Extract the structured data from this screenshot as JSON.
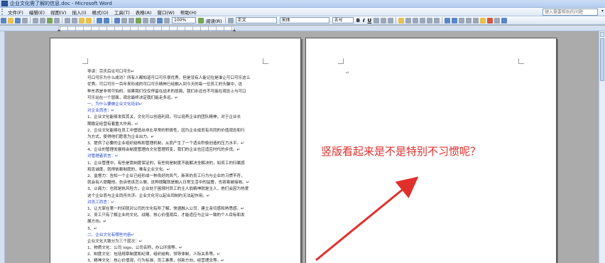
{
  "window": {
    "title": "企业文化需了解的信息.doc - Microsoft Word"
  },
  "menu": {
    "items": [
      "文件(F)",
      "编辑(E)",
      "视图(V)",
      "插入(I)",
      "格式(O)",
      "工具(T)",
      "表格(A)",
      "窗口(W)",
      "帮助(H)"
    ],
    "help_placeholder": "键入需要帮助的问题"
  },
  "toolbar": {
    "zoom": "100%",
    "read_button": "阅读(R)",
    "style": "正文",
    "font": "宋体",
    "size": "五号",
    "bold": "B",
    "italic": "I",
    "underline": "U"
  },
  "document": {
    "lines": [
      {
        "text": "导读：宗庆后论可口可乐↵",
        "color": "normal"
      },
      {
        "text": "可口可乐为什么成功？所有人都知道可口可乐很优秀，但是没有人能记住是谁让可口可乐这么",
        "color": "normal"
      },
      {
        "text": "优秀。可口可乐一百年来形成的可口可乐精神已经融入到今天的每一位员工的头脑中，这",
        "color": "normal"
      },
      {
        "text": "种东西是非常可怕的。如果我们仅仅停留在战术的层面，我们永远也不可能在观念上与可口",
        "color": "normal"
      },
      {
        "text": "可乐站在一个层面，观念最终决定我们能走多远。↵",
        "color": "normal"
      },
      {
        "text": "一、为什么要做企业文化培训↵",
        "color": "blue"
      },
      {
        "text": "对企业而言：↵",
        "color": "blue"
      },
      {
        "text": "1、企业文化能够发挥其关，文化可以创造利润，可以培养企业的团队精神，对于企业长",
        "color": "normal"
      },
      {
        "text": "期稳定经营有着重大作用。↵",
        "color": "normal"
      },
      {
        "text": "2、企业文化能够在员工中塑造出非比寻常的积极性，因为企业成员有共同的价值观念和行",
        "color": "normal"
      },
      {
        "text": "为方式，使得他们愿意为企业出力。↵",
        "color": "normal"
      },
      {
        "text": "3、提供了必要的企业组织结构和管理机制，从而产生了一个适合积极创造的压力水平。↵",
        "color": "normal"
      },
      {
        "text": "4、企业的管理发展将由制度管理向文化管理转变，我们的企业也应适应时代的步伐。↵",
        "color": "normal"
      },
      {
        "text": "对管理者而言：↵",
        "color": "blue"
      },
      {
        "text": "1、企业管理中，有些是靠制度保证的，有些则是制度不能解决全解决的，如员工的归属感",
        "color": "normal"
      },
      {
        "text": "和忠诚度，就得依赖制度的，唯有企业文化。↵",
        "color": "normal"
      },
      {
        "text": "2、监督力：告知一个企业已经形成一种良好的风气，新来的员工行为与企业的习惯不符，",
        "color": "normal"
      },
      {
        "text": "就会有人提醒他，告诉他该怎么做，这种提醒就是融入日常生活中的监督，也容易被接收。↵",
        "color": "normal"
      },
      {
        "text": "3、止痛力：也就是执风险力，企业处于困境时员工的主人翁精神就是主人，他们会因为热爱",
        "color": "normal"
      },
      {
        "text": "这个企业而与企业同舟共济。企业文化可以起合同制约无法起作用。↵",
        "color": "normal"
      },
      {
        "text": "对员工而言：↵",
        "color": "blue"
      },
      {
        "text": "1、让大家在第一时间就对公司的文化有所了解，快速融入公司，建立亲切感和熟悉感。↵",
        "color": "normal"
      },
      {
        "text": "2、员工只有了解企业的文化、战略、核心价值观后，才能适应与企业一致的个人目标和发",
        "color": "normal"
      },
      {
        "text": "展方向。↵",
        "color": "normal"
      },
      {
        "text": "3、↵",
        "color": "normal"
      },
      {
        "text": "二、企业文化有哪些内容↵",
        "color": "blue"
      },
      {
        "text": "企业文化大致分为三个层次：↵",
        "color": "normal"
      },
      {
        "text": "1、物质文化：公司 logo，公司名称，办公环境等。↵",
        "color": "normal"
      },
      {
        "text": "2、制度文化：包括规章制度和纪律，组织结构，领导体制，人际关系等。↵",
        "color": "normal"
      },
      {
        "text": "3、精神文化：核心价值观，行为标准，员工素质，创新方向，经营理念等。↵",
        "color": "normal"
      }
    ]
  },
  "annotation": {
    "text": "竖版看起来是不是特别不习惯呢？",
    "color": "#e0302c"
  }
}
